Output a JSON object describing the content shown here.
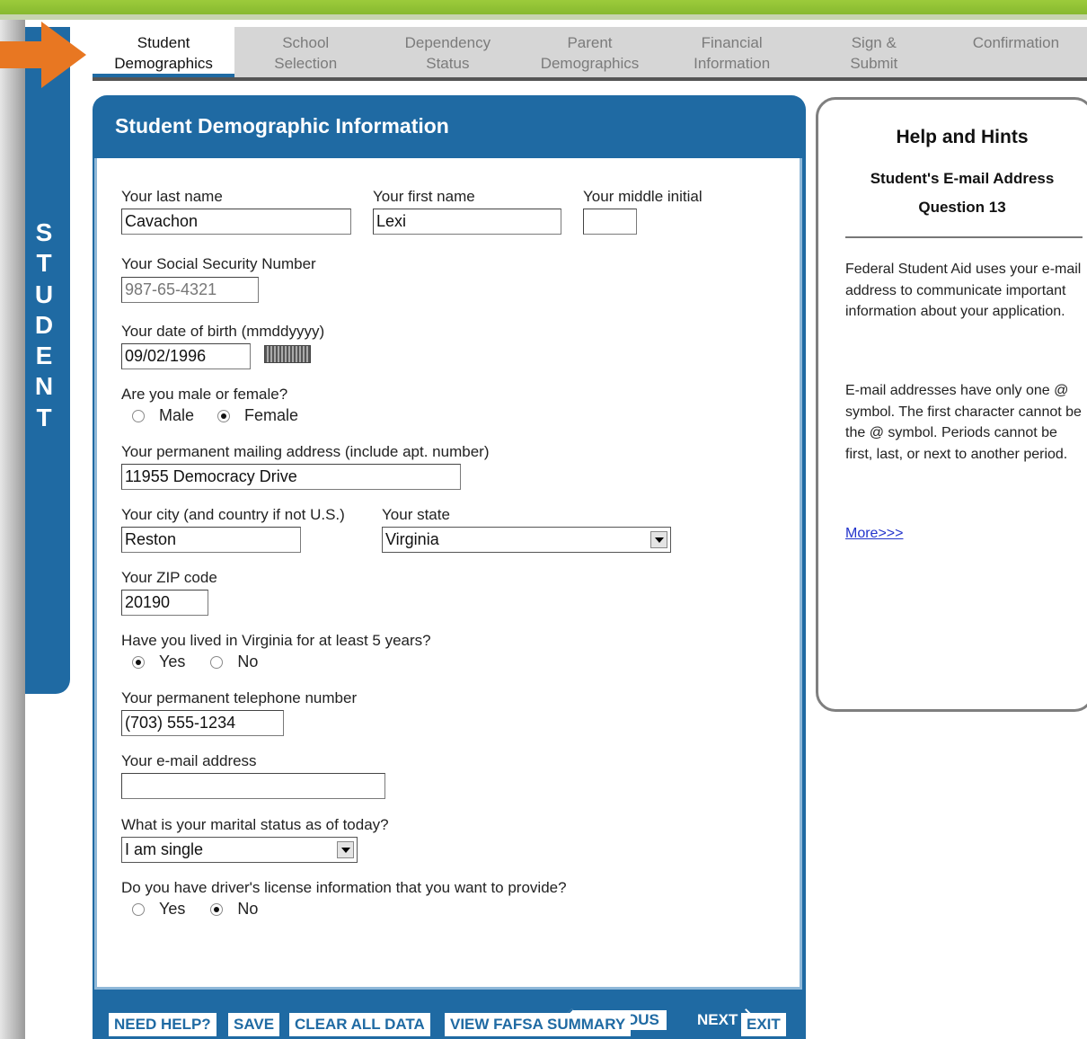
{
  "nav": {
    "tabs": [
      {
        "line1": "Student",
        "line2": "Demographics"
      },
      {
        "line1": "School",
        "line2": "Selection"
      },
      {
        "line1": "Dependency",
        "line2": "Status"
      },
      {
        "line1": "Parent",
        "line2": "Demographics"
      },
      {
        "line1": "Financial",
        "line2": "Information"
      },
      {
        "line1": "Sign &",
        "line2": "Submit"
      },
      {
        "line1": "Confirmation",
        "line2": ""
      }
    ]
  },
  "side_tab": {
    "letters": [
      "S",
      "T",
      "U",
      "D",
      "E",
      "N",
      "T"
    ]
  },
  "form": {
    "title": "Student Demographic Information",
    "last_name_label": "Your last name",
    "last_name_value": "Cavachon",
    "first_name_label": "Your first name",
    "first_name_value": "Lexi",
    "middle_initial_label": "Your middle initial",
    "middle_initial_value": "",
    "ssn_label": "Your Social Security Number",
    "ssn_value": "987-65-4321",
    "dob_label": "Your date of birth (mmddyyyy)",
    "dob_value": "09/02/1996",
    "gender_label": "Are you male or female?",
    "gender_male": "Male",
    "gender_female": "Female",
    "address_label": "Your permanent mailing address (include apt. number)",
    "address_value": "11955 Democracy Drive",
    "city_label": "Your city (and country if not U.S.)",
    "city_value": "Reston",
    "state_label": "Your state",
    "state_value": "Virginia",
    "zip_label": "Your ZIP code",
    "zip_value": "20190",
    "residency_label": "Have you lived in Virginia for at least 5 years?",
    "residency_yes": "Yes",
    "residency_no": "No",
    "phone_label": "Your permanent telephone number",
    "phone_value": "(703) 555-1234",
    "email_label": "Your e-mail address",
    "email_value": "",
    "marital_label": "What is your marital status as of today?",
    "marital_value": "I am single",
    "license_label": "Do you have driver's license information that you want to provide?",
    "license_yes": "Yes",
    "license_no": "No",
    "previous_label": "PREVIOUS",
    "next_label": "NEXT"
  },
  "bottom": {
    "need_help": "NEED HELP?",
    "save": "SAVE",
    "clear": "CLEAR ALL DATA",
    "summary": "VIEW FAFSA SUMMARY",
    "exit": "EXIT"
  },
  "help": {
    "title": "Help and Hints",
    "subtitle": "Student's E-mail Address",
    "question": "Question 13",
    "para1": "Federal Student Aid uses your e-mail address to communicate important information about your application.",
    "para2": "E-mail addresses have only one @ symbol. The first character cannot be the @ symbol. Periods cannot be first, last, or next to another period.",
    "more_link": "More>>>"
  },
  "colors": {
    "accent": "#1f6aa3",
    "green": "#8cc034",
    "arrow": "#e87722"
  }
}
